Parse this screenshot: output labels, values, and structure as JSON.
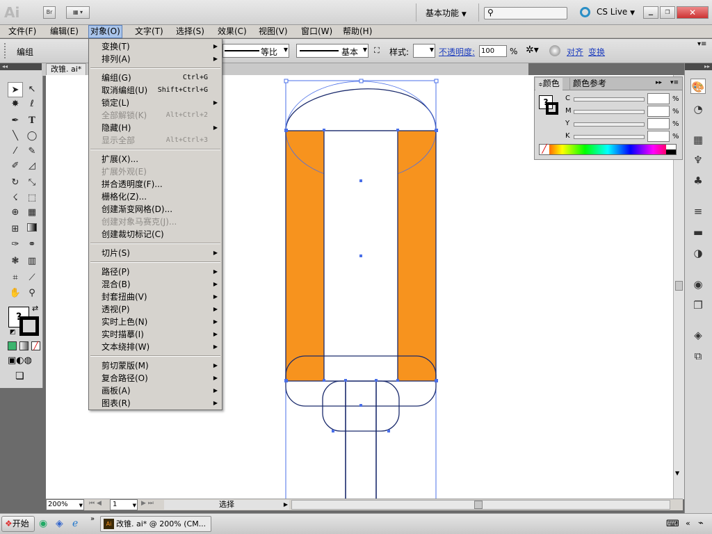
{
  "app": {
    "logo": "Ai",
    "bridge_label": "Br",
    "workspace_label": "基本功能",
    "cs_live_label": "CS Live",
    "search_placeholder": ""
  },
  "menubar": [
    "文件(F)",
    "编辑(E)",
    "对象(O)",
    "文字(T)",
    "选择(S)",
    "效果(C)",
    "视图(V)",
    "窗口(W)",
    "帮助(H)"
  ],
  "controlbar": {
    "selection_label": "编组",
    "stroke_profile": "等比",
    "brush_label": "基本",
    "style_label": "样式:",
    "opacity_label": "不透明度:",
    "opacity_value": "100",
    "opacity_unit": "%",
    "align_label": "对齐",
    "transform_label": "变换"
  },
  "document_tab": "改锥. ai*",
  "object_menu": {
    "groups": [
      [
        {
          "label": "变换(T)",
          "shortcut": "",
          "submenu": true,
          "disabled": false
        },
        {
          "label": "排列(A)",
          "shortcut": "",
          "submenu": true,
          "disabled": false
        }
      ],
      [
        {
          "label": "编组(G)",
          "shortcut": "Ctrl+G",
          "submenu": false,
          "disabled": false
        },
        {
          "label": "取消编组(U)",
          "shortcut": "Shift+Ctrl+G",
          "submenu": false,
          "disabled": false
        },
        {
          "label": "锁定(L)",
          "shortcut": "",
          "submenu": true,
          "disabled": false
        },
        {
          "label": "全部解锁(K)",
          "shortcut": "Alt+Ctrl+2",
          "submenu": false,
          "disabled": true
        },
        {
          "label": "隐藏(H)",
          "shortcut": "",
          "submenu": true,
          "disabled": false
        },
        {
          "label": "显示全部",
          "shortcut": "Alt+Ctrl+3",
          "submenu": false,
          "disabled": true
        }
      ],
      [
        {
          "label": "扩展(X)...",
          "shortcut": "",
          "submenu": false,
          "disabled": false
        },
        {
          "label": "扩展外观(E)",
          "shortcut": "",
          "submenu": false,
          "disabled": true
        },
        {
          "label": "拼合透明度(F)...",
          "shortcut": "",
          "submenu": false,
          "disabled": false
        },
        {
          "label": "栅格化(Z)...",
          "shortcut": "",
          "submenu": false,
          "disabled": false
        },
        {
          "label": "创建渐变网格(D)...",
          "shortcut": "",
          "submenu": false,
          "disabled": false
        },
        {
          "label": "创建对象马赛克(J)...",
          "shortcut": "",
          "submenu": false,
          "disabled": true
        },
        {
          "label": "创建裁切标记(C)",
          "shortcut": "",
          "submenu": false,
          "disabled": false
        }
      ],
      [
        {
          "label": "切片(S)",
          "shortcut": "",
          "submenu": true,
          "disabled": false
        }
      ],
      [
        {
          "label": "路径(P)",
          "shortcut": "",
          "submenu": true,
          "disabled": false
        },
        {
          "label": "混合(B)",
          "shortcut": "",
          "submenu": true,
          "disabled": false
        },
        {
          "label": "封套扭曲(V)",
          "shortcut": "",
          "submenu": true,
          "disabled": false
        },
        {
          "label": "透视(P)",
          "shortcut": "",
          "submenu": true,
          "disabled": false
        },
        {
          "label": "实时上色(N)",
          "shortcut": "",
          "submenu": true,
          "disabled": false
        },
        {
          "label": "实时描摹(I)",
          "shortcut": "",
          "submenu": true,
          "disabled": false
        },
        {
          "label": "文本绕排(W)",
          "shortcut": "",
          "submenu": true,
          "disabled": false
        }
      ],
      [
        {
          "label": "剪切蒙版(M)",
          "shortcut": "",
          "submenu": true,
          "disabled": false
        },
        {
          "label": "复合路径(O)",
          "shortcut": "",
          "submenu": true,
          "disabled": false
        },
        {
          "label": "画板(A)",
          "shortcut": "",
          "submenu": true,
          "disabled": false
        },
        {
          "label": "图表(R)",
          "shortcut": "",
          "submenu": true,
          "disabled": false
        }
      ]
    ]
  },
  "color_panel": {
    "tab_color": "颜色",
    "tab_guide": "颜色参考",
    "channels": [
      {
        "name": "C",
        "unit": "%"
      },
      {
        "name": "M",
        "unit": "%"
      },
      {
        "name": "Y",
        "unit": "%"
      },
      {
        "name": "K",
        "unit": "%"
      }
    ]
  },
  "statusbar": {
    "zoom": "200%",
    "artboard": "1",
    "tool": "选择"
  },
  "taskbar": {
    "start_label": "开始",
    "window_label": "改锥. ai* @ 200% (CM..."
  },
  "colors": {
    "orange_fill": "#f7931e",
    "selection_blue": "#4a6fe8",
    "stroke_navy": "#1a2a6c"
  },
  "icons": [
    "selection-icon",
    "direct-selection-icon",
    "magic-wand-icon",
    "lasso-icon",
    "pen-icon",
    "type-icon",
    "line-icon",
    "ellipse-icon",
    "brush-icon",
    "pencil-icon",
    "eraser-icon",
    "rotate-icon",
    "scale-icon",
    "warp-icon",
    "free-transform-icon",
    "symbol-sprayer-icon",
    "graph-icon",
    "mesh-icon",
    "gradient-icon",
    "eyedropper-icon",
    "blend-icon",
    "slice-icon",
    "hand-icon",
    "zoom-icon"
  ]
}
